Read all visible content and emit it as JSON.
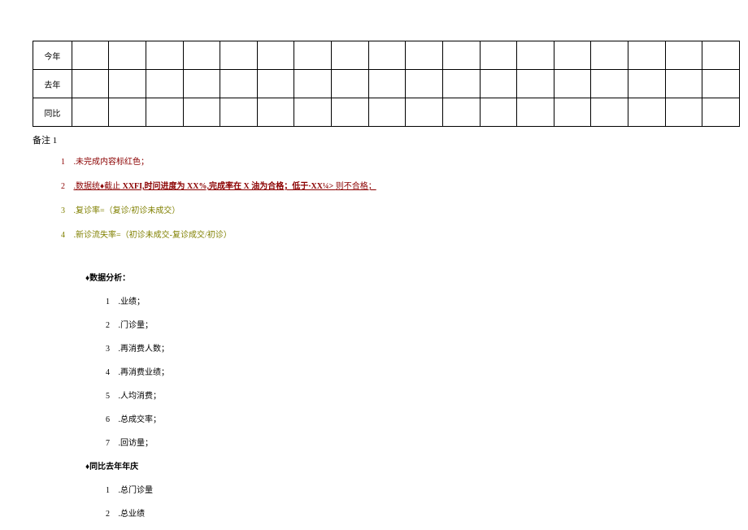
{
  "table": {
    "rows": [
      {
        "label": "今年"
      },
      {
        "label": "去年"
      },
      {
        "label": "同比"
      }
    ],
    "columns": 18
  },
  "notes": {
    "title": "备注 1",
    "items": [
      {
        "num": "1",
        "text": ".未完成内容标红色；",
        "style": "red"
      },
      {
        "num": "2",
        "prefix": ".数据统♦截止",
        "mid": " XXFI,时问进度为 XX%,完成率在 X 油为合格；低于·XX¼> ",
        "suffix": "则不合格；",
        "style": "red underline"
      },
      {
        "num": "3",
        "text": ".复诊率=（复诊/初诊未成交）",
        "style": "olive"
      },
      {
        "num": "4",
        "text": ".新诊流失率=（初诊未成交-复诊成交/初诊）",
        "style": "olive"
      }
    ]
  },
  "analysis": {
    "title": "♦数据分析：",
    "items": [
      {
        "num": "1",
        "text": ".业绩；"
      },
      {
        "num": "2",
        "text": ".门诊量；"
      },
      {
        "num": "3",
        "text": ".再消费人数；"
      },
      {
        "num": "4",
        "text": ".再消费业绩；"
      },
      {
        "num": "5",
        "text": ".人均消费；"
      },
      {
        "num": "6",
        "text": ".总成交率；"
      },
      {
        "num": "7",
        "text": ".回访量；"
      }
    ]
  },
  "comparison": {
    "title": "♦同比去年年庆",
    "items": [
      {
        "num": "1",
        "text": ".总门诊量"
      },
      {
        "num": "2",
        "text": ".总业绩"
      }
    ]
  }
}
